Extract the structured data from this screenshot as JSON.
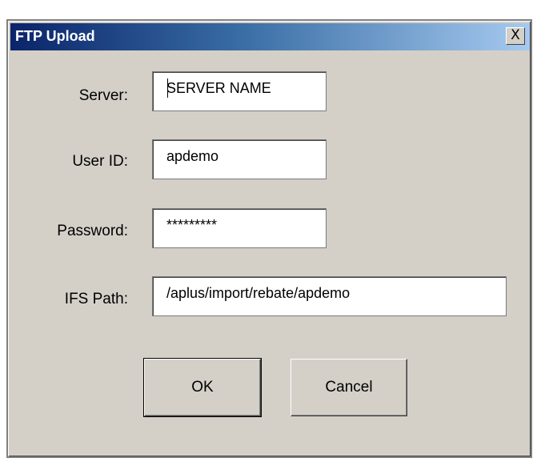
{
  "window": {
    "title": "FTP Upload",
    "close_glyph": "X"
  },
  "form": {
    "server_label": "Server:",
    "server_value": "SERVER NAME",
    "userid_label": "User ID:",
    "userid_value": "apdemo",
    "password_label": "Password:",
    "password_value": "*********",
    "ifs_label": "IFS Path:",
    "ifs_value": "/aplus/import/rebate/apdemo"
  },
  "buttons": {
    "ok_label": "OK",
    "cancel_label": "Cancel"
  },
  "colors": {
    "title_gradient_start": "#0a246a",
    "title_gradient_end": "#a6caf0",
    "dialog_face": "#d4d0c8"
  },
  "icons": {
    "close": "close-icon"
  }
}
